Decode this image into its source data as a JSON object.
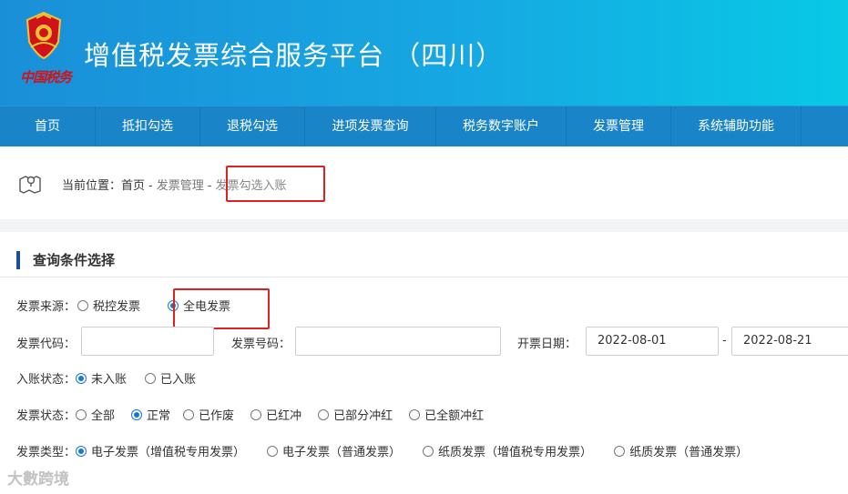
{
  "header": {
    "title": "增值税发票综合服务平台 （四川）",
    "emblem_text": "中国税务"
  },
  "nav": [
    {
      "label": "首页",
      "width": 105
    },
    {
      "label": "抵扣勾选",
      "width": 115
    },
    {
      "label": "退税勾选",
      "width": 115
    },
    {
      "label": "进项发票查询",
      "width": 144
    },
    {
      "label": "税务数字账户",
      "width": 143
    },
    {
      "label": "发票管理",
      "width": 115
    },
    {
      "label": "系统辅助功能",
      "width": 143
    }
  ],
  "breadcrumb": {
    "prefix": "当前位置：",
    "home": "首页",
    "sep": "-",
    "level2": "发票管理",
    "current": "发票勾选入账"
  },
  "panel": {
    "title": "查询条件选择"
  },
  "filters": {
    "invoice_source": {
      "label": "发票来源：",
      "options": [
        {
          "label": "税控发票",
          "selected": false
        },
        {
          "label": "全电发票",
          "selected": true
        }
      ]
    },
    "invoice_code": {
      "label": "发票代码：",
      "value": ""
    },
    "invoice_number": {
      "label": "发票号码：",
      "value": ""
    },
    "issue_date": {
      "label": "开票日期：",
      "from": "2022-08-01",
      "sep": "-",
      "to": "2022-08-21"
    },
    "entry_status": {
      "label": "入账状态：",
      "options": [
        {
          "label": "未入账",
          "selected": true
        },
        {
          "label": "已入账",
          "selected": false
        }
      ]
    },
    "invoice_status": {
      "label": "发票状态：",
      "options": [
        {
          "label": "全部",
          "selected": false
        },
        {
          "label": "正常",
          "selected": true
        },
        {
          "label": "已作废",
          "selected": false
        },
        {
          "label": "已红冲",
          "selected": false
        },
        {
          "label": "已部分冲红",
          "selected": false
        },
        {
          "label": "已全额冲红",
          "selected": false
        }
      ]
    },
    "invoice_type": {
      "label": "发票类型：",
      "options": [
        {
          "label": "电子发票（增值税专用发票）",
          "selected": true
        },
        {
          "label": "电子发票（普通发票）",
          "selected": false
        },
        {
          "label": "纸质发票（增值税专用发票）",
          "selected": false
        },
        {
          "label": "纸质发票（普通发票）",
          "selected": false
        }
      ]
    }
  },
  "watermark": "大數跨境",
  "colors": {
    "header_start": "#1a8fd8",
    "header_end": "#08c9e6",
    "nav_bg": "#1a84c8",
    "accent": "#1677d6",
    "highlight": "#e02020"
  }
}
